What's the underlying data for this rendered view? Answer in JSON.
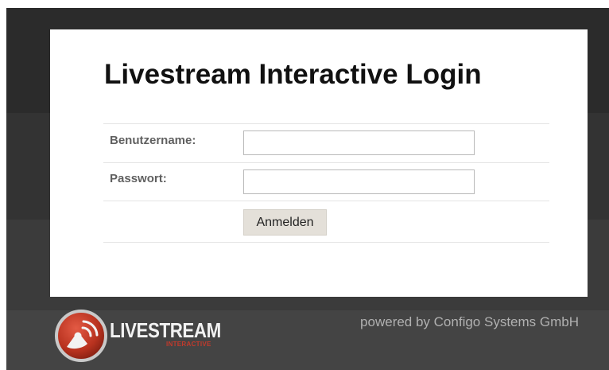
{
  "login": {
    "title": "Livestream Interactive Login",
    "username_label": "Benutzername:",
    "username_value": "",
    "password_label": "Passwort:",
    "password_value": "",
    "submit_label": "Anmelden"
  },
  "footer": {
    "logo_name": "LIVESTREAM",
    "logo_sub": "INTERACTIVE",
    "powered_by": "powered by Configo Systems GmbH"
  },
  "colors": {
    "background": "#2b2b2b",
    "card": "#ffffff",
    "brand_red": "#c23a2c",
    "button": "#e4e0d9"
  },
  "icons": {
    "logo": "livestream-logo-icon"
  }
}
